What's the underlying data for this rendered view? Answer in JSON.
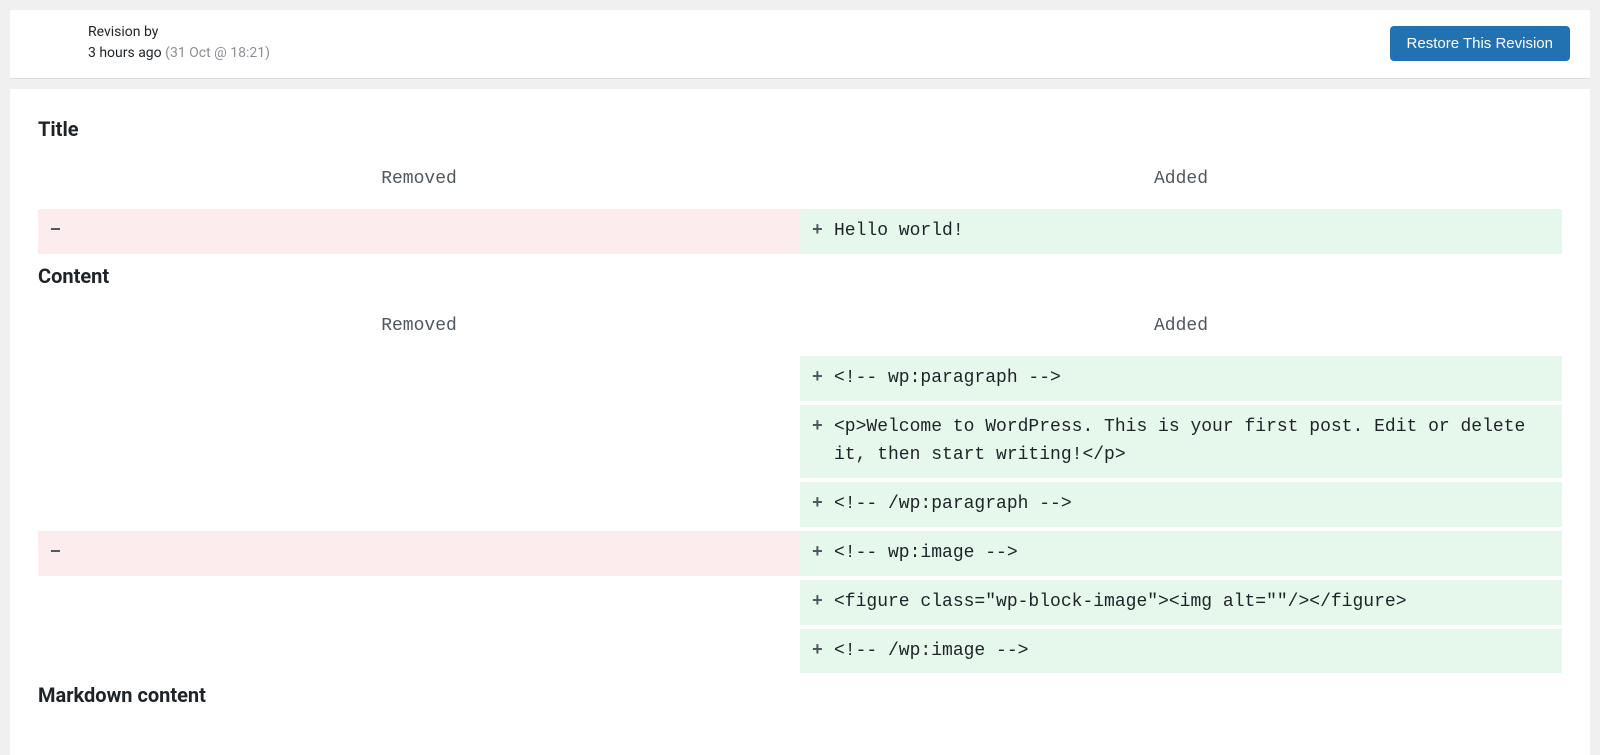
{
  "header": {
    "revision_by_label": "Revision by",
    "time_ago": "3 hours ago",
    "timestamp": "(31 Oct @ 18:21)",
    "restore_button_label": "Restore This Revision"
  },
  "columns": {
    "removed_label": "Removed",
    "added_label": "Added"
  },
  "sections": [
    {
      "id": "title",
      "heading": "Title",
      "rows": [
        {
          "removed": "",
          "added": "Hello world!"
        }
      ]
    },
    {
      "id": "content",
      "heading": "Content",
      "rows": [
        {
          "removed": null,
          "added": "<!-- wp:paragraph -->"
        },
        {
          "removed": null,
          "added": "<p>Welcome to WordPress. This is your first post. Edit or delete it, then start writing!</p>"
        },
        {
          "removed": null,
          "added": "<!-- /wp:paragraph -->"
        },
        {
          "removed": "",
          "added": "<!-- wp:image -->"
        },
        {
          "removed": null,
          "added": "<figure class=\"wp-block-image\"><img alt=\"\"/></figure>"
        },
        {
          "removed": null,
          "added": "<!-- /wp:image -->"
        }
      ]
    },
    {
      "id": "markdown",
      "heading": "Markdown content",
      "rows": []
    }
  ]
}
